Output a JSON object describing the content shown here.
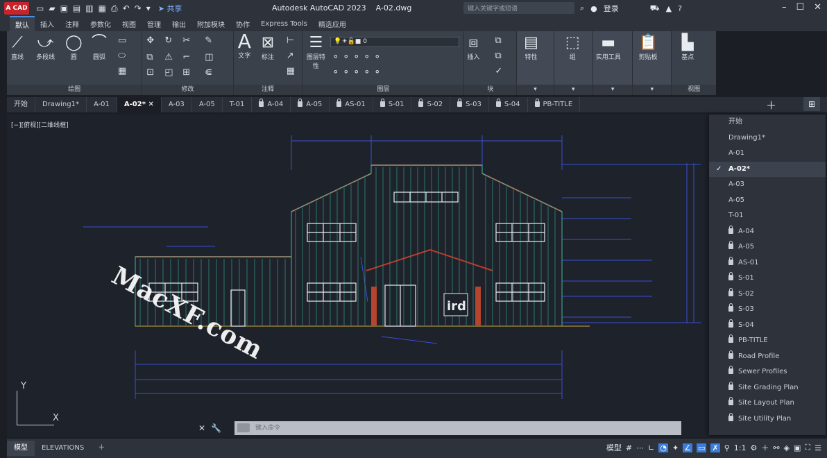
{
  "titlebar": {
    "logo": "A CAD",
    "share": "共享",
    "app_title": "Autodesk AutoCAD 2023",
    "file_name": "A-02.dwg",
    "search_placeholder": "键入关键字或短语",
    "login": "登录"
  },
  "ribbon_tabs": [
    "默认",
    "插入",
    "注释",
    "参数化",
    "视图",
    "管理",
    "输出",
    "附加模块",
    "协作",
    "Express Tools",
    "精选应用"
  ],
  "ribbon": {
    "draw": {
      "title": "绘图",
      "line": "直线",
      "polyline": "多段线",
      "circle": "圆",
      "arc": "圆弧"
    },
    "modify": {
      "title": "修改"
    },
    "annotation": {
      "title": "注释",
      "text": "文字",
      "dimension": "标注"
    },
    "layers": {
      "title": "图层",
      "layer_props": "图层特性",
      "layer_value": "0"
    },
    "block": {
      "title": "块",
      "insert": "插入"
    },
    "properties": "特性",
    "group": "组",
    "utilities": "实用工具",
    "clipboard": "剪贴板",
    "view": {
      "title": "视图",
      "base": "基点"
    }
  },
  "file_tabs": [
    {
      "label": "开始",
      "locked": false
    },
    {
      "label": "Drawing1*",
      "locked": false
    },
    {
      "label": "A-01",
      "locked": false
    },
    {
      "label": "A-02*",
      "locked": false,
      "active": true
    },
    {
      "label": "A-03",
      "locked": false
    },
    {
      "label": "A-05",
      "locked": false
    },
    {
      "label": "T-01",
      "locked": false
    },
    {
      "label": "A-04",
      "locked": true
    },
    {
      "label": "A-05",
      "locked": true
    },
    {
      "label": "AS-01",
      "locked": true
    },
    {
      "label": "S-01",
      "locked": true
    },
    {
      "label": "S-02",
      "locked": true
    },
    {
      "label": "S-03",
      "locked": true
    },
    {
      "label": "S-04",
      "locked": true
    },
    {
      "label": "PB-TITLE",
      "locked": true
    }
  ],
  "canvas": {
    "view_label": "[−][俯视][二维线框]",
    "ucs_x": "X",
    "ucs_y": "Y",
    "sign_text": "ird"
  },
  "tab_list": [
    {
      "label": "开始",
      "locked": false
    },
    {
      "label": "Drawing1*",
      "locked": false
    },
    {
      "label": "A-01",
      "locked": false
    },
    {
      "label": "A-02*",
      "locked": false,
      "checked": true
    },
    {
      "label": "A-03",
      "locked": false
    },
    {
      "label": "A-05",
      "locked": false
    },
    {
      "label": "T-01",
      "locked": false
    },
    {
      "label": "A-04",
      "locked": true
    },
    {
      "label": "A-05",
      "locked": true
    },
    {
      "label": "AS-01",
      "locked": true
    },
    {
      "label": "S-01",
      "locked": true
    },
    {
      "label": "S-02",
      "locked": true
    },
    {
      "label": "S-03",
      "locked": true
    },
    {
      "label": "S-04",
      "locked": true
    },
    {
      "label": "PB-TITLE",
      "locked": true
    },
    {
      "label": "Road Profile",
      "locked": true
    },
    {
      "label": "Sewer Profiles",
      "locked": true
    },
    {
      "label": "Site Grading Plan",
      "locked": true
    },
    {
      "label": "Site Layout Plan",
      "locked": true
    },
    {
      "label": "Site Utility Plan",
      "locked": true
    }
  ],
  "command": {
    "placeholder": "键入命令"
  },
  "status": {
    "model_tab": "模型",
    "layout_tab": "ELEVATIONS",
    "model_btn": "模型",
    "scale": "1:1"
  },
  "watermark": "MacXF.com",
  "colors": {
    "accent": "#3b7dd8",
    "dim_blue": "#3a4fd6",
    "wall_green": "#3fb8a0",
    "roof_red": "#c0392b",
    "bg": "#1e222a"
  }
}
